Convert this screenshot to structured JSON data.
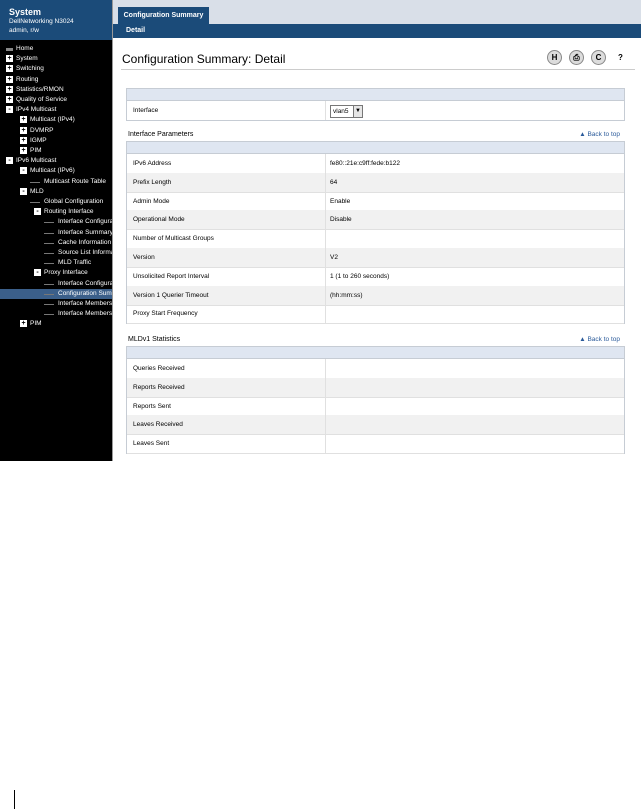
{
  "sidebar": {
    "title": "System",
    "device": "DellNetworking N3024",
    "user": "admin, r/w",
    "tree": [
      {
        "label": "Home",
        "level": 0,
        "expander": "",
        "type": "root"
      },
      {
        "label": "System",
        "level": 0,
        "expander": "+"
      },
      {
        "label": "Switching",
        "level": 0,
        "expander": "+"
      },
      {
        "label": "Routing",
        "level": 0,
        "expander": "+"
      },
      {
        "label": "Statistics/RMON",
        "level": 0,
        "expander": "+"
      },
      {
        "label": "Quality of Service",
        "level": 0,
        "expander": "+"
      },
      {
        "label": "IPv4 Multicast",
        "level": 0,
        "expander": "-"
      },
      {
        "label": "Multicast (IPv4)",
        "level": 1,
        "expander": "+"
      },
      {
        "label": "DVMRP",
        "level": 1,
        "expander": "+"
      },
      {
        "label": "IGMP",
        "level": 1,
        "expander": "+"
      },
      {
        "label": "PIM",
        "level": 1,
        "expander": "+"
      },
      {
        "label": "IPv6 Multicast",
        "level": 0,
        "expander": "-"
      },
      {
        "label": "Multicast (IPv6)",
        "level": 1,
        "expander": "-"
      },
      {
        "label": "Multicast Route Table",
        "level": 2,
        "expander": ""
      },
      {
        "label": "MLD",
        "level": 1,
        "expander": "-"
      },
      {
        "label": "Global Configuration",
        "level": 2,
        "expander": ""
      },
      {
        "label": "Routing Interface",
        "level": 2,
        "expander": "-"
      },
      {
        "label": "Interface Configuration",
        "level": 3,
        "expander": ""
      },
      {
        "label": "Interface Summary",
        "level": 3,
        "expander": ""
      },
      {
        "label": "Cache Information",
        "level": 3,
        "expander": ""
      },
      {
        "label": "Source List Information",
        "level": 3,
        "expander": ""
      },
      {
        "label": "MLD Traffic",
        "level": 3,
        "expander": ""
      },
      {
        "label": "Proxy Interface",
        "level": 2,
        "expander": "-"
      },
      {
        "label": "Interface Configuration",
        "level": 3,
        "expander": ""
      },
      {
        "label": "Configuration Summary",
        "level": 3,
        "expander": "",
        "selected": true
      },
      {
        "label": "Interface Membership",
        "level": 3,
        "expander": ""
      },
      {
        "label": "Interface Membership Detail",
        "level": 3,
        "expander": ""
      },
      {
        "label": "PIM",
        "level": 1,
        "expander": "+"
      }
    ]
  },
  "tabs": {
    "main": "Configuration Summary",
    "sub": "Detail"
  },
  "page": {
    "title": "Configuration Summary: Detail"
  },
  "toolbar": {
    "save_icon": "H",
    "print_icon": "⎙",
    "refresh_icon": "C",
    "help_icon": "?"
  },
  "interface_select": {
    "label": "Interface",
    "value": "vlan5"
  },
  "interface_parameters": {
    "title": "Interface Parameters",
    "back_to_top": "Back to top",
    "rows": [
      {
        "label": "IPv6 Address",
        "value": "fe80::21e:c9ff:fede:b122"
      },
      {
        "label": "Prefix Length",
        "value": "64"
      },
      {
        "label": "Admin Mode",
        "value": "Enable"
      },
      {
        "label": "Operational Mode",
        "value": "Disable"
      },
      {
        "label": "Number of Multicast Groups",
        "value": ""
      },
      {
        "label": "Version",
        "value": "V2"
      },
      {
        "label": "Unsolicited Report Interval",
        "value": "1  (1 to 260 seconds)"
      },
      {
        "label": "Version 1 Querier Timeout",
        "value": "    (hh:mm:ss)"
      },
      {
        "label": "Proxy Start Frequency",
        "value": ""
      }
    ]
  },
  "mld_statistics": {
    "title": "MLDv1 Statistics",
    "back_to_top": "Back to top",
    "rows": [
      {
        "label": "Queries Received",
        "value": ""
      },
      {
        "label": "Reports Received",
        "value": ""
      },
      {
        "label": "Reports Sent",
        "value": ""
      },
      {
        "label": "Leaves Received",
        "value": ""
      },
      {
        "label": "Leaves Sent",
        "value": ""
      }
    ]
  }
}
